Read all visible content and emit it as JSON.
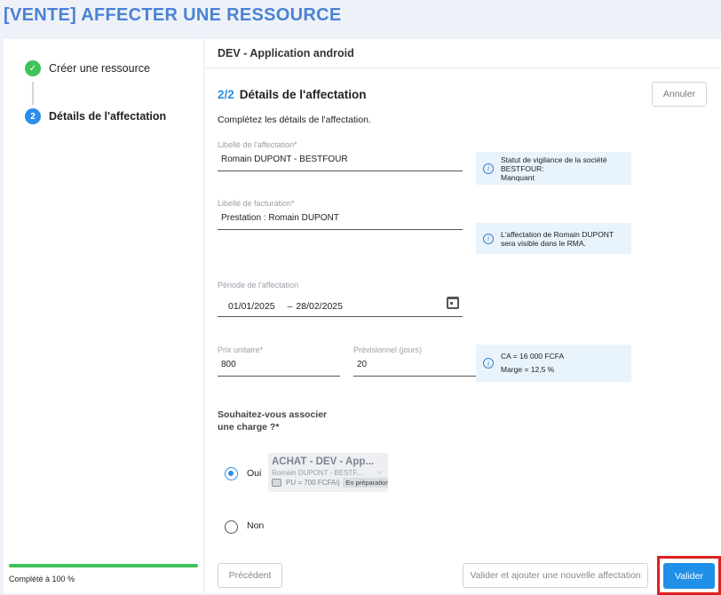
{
  "page": {
    "title": "[VENTE] AFFECTER UNE RESSOURCE"
  },
  "stepper": {
    "steps": [
      {
        "label": "Créer une ressource",
        "state": "done"
      },
      {
        "number": "2",
        "label": "Détails de l'affectation",
        "state": "active"
      }
    ],
    "progress": {
      "text": "Complété à 100 %",
      "percent": 100
    }
  },
  "main": {
    "header_title": "DEV - Application android",
    "section": {
      "number": "2/2",
      "title": "Détails de l'affectation",
      "description": "Complétez les détails de l'affectation."
    },
    "cancel_label": "Annuler"
  },
  "form": {
    "libelle_affectation": {
      "label": "Libellé de l'affectation*",
      "value": "Romain DUPONT - BESTFOUR"
    },
    "libelle_facturation": {
      "label": "Libellé de facturation*",
      "value": "Prestation : Romain DUPONT"
    },
    "periode": {
      "label": "Période de l'affectation",
      "start": "01/01/2025",
      "separator": "–",
      "end": "28/02/2025"
    },
    "prix_unitaire": {
      "label": "Prix unitaire*",
      "value": "800"
    },
    "previsionnel": {
      "label": "Prévisionnel (jours)",
      "value": "20"
    },
    "question": "Souhaitez-vous associer une charge ?*",
    "options": {
      "oui": "Oui",
      "non": "Non",
      "selected": "oui"
    },
    "charge": {
      "title": "ACHAT - DEV - App...",
      "subtitle": "Romain DUPONT - BESTF...",
      "price": "PU = 700 FCFA/j",
      "status": "En préparation"
    }
  },
  "info": {
    "vigilance_line1": "Statut de vigilance de la société BESTFOUR:",
    "vigilance_line2": "Manquant",
    "rma_line1": "L'affectation de Romain DUPONT",
    "rma_line2": "sera visible dans le RMA.",
    "ca": "CA = 16 000 FCFA",
    "marge": "Marge = 12,5 %"
  },
  "footer": {
    "previous_label": "Précédent",
    "validate_add_label": "Valider et ajouter une nouvelle affectation",
    "validate_label": "Valider"
  },
  "colors": {
    "accent": "#2a8ee8",
    "success": "#3ec25a",
    "title": "#4a82d4",
    "highlight": "#e0201f"
  }
}
